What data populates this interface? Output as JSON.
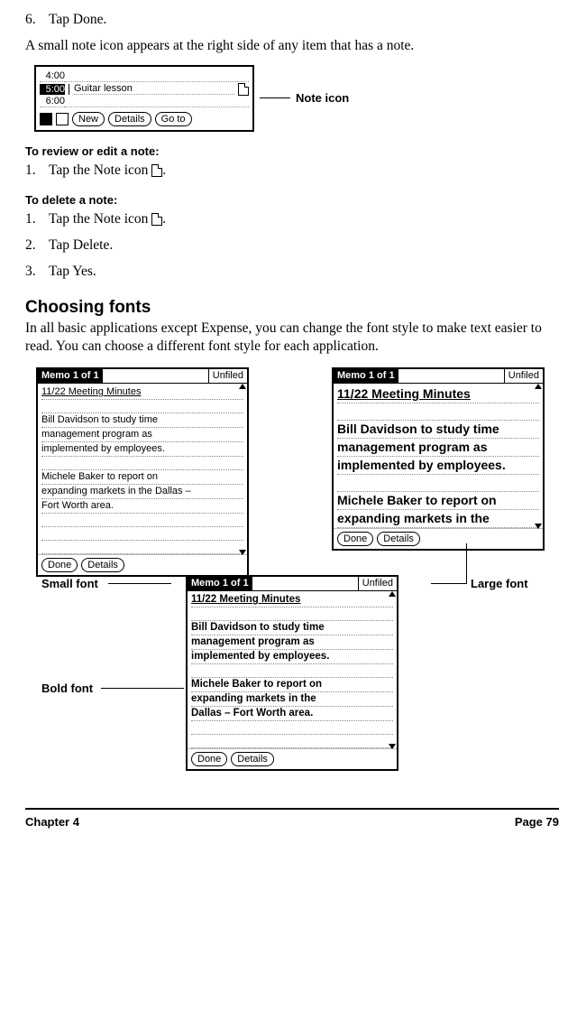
{
  "steps_top": {
    "num6": "6.",
    "text6": "Tap Done."
  },
  "para_noteicon": "A small note icon appears at the right side of any item that has a note.",
  "noteicon_figure": {
    "times": [
      "4:00",
      "5:00",
      "6:00"
    ],
    "event": "Guitar lesson",
    "btn_new": "New",
    "btn_details": "Details",
    "btn_goto": "Go to",
    "callout": "Note icon"
  },
  "h_review": "To review or edit a note:",
  "review_step1_num": "1.",
  "review_step1_text": "Tap the Note icon ",
  "review_step1_trail": ".",
  "h_delete": "To delete a note:",
  "delete_steps": [
    {
      "num": "1.",
      "text": "Tap the Note icon ",
      "trail": "."
    },
    {
      "num": "2.",
      "text": "Tap Delete.",
      "trail": ""
    },
    {
      "num": "3.",
      "text": "Tap Yes.",
      "trail": ""
    }
  ],
  "h_fonts": "Choosing fonts",
  "para_fonts": "In all basic applications except Expense, you can change the font style to make text easier to read. You can choose a different font style for each application.",
  "memo_common": {
    "title": "Memo 1 of 1",
    "category": "Unfiled",
    "line1": "11/22 Meeting Minutes",
    "para1a": "Bill Davidson to study time",
    "para1b": "management program as",
    "para1c": "implemented by employees.",
    "para2a": "Michele Baker to report on",
    "para2b": "expanding markets in the Dallas –",
    "para2c": "Fort Worth area.",
    "btn_done": "Done",
    "btn_details": "Details"
  },
  "memo_large": {
    "para2a": "Michele Baker to report on",
    "para2b": "expanding markets in the"
  },
  "memo_bold": {
    "para2b": "expanding markets in the",
    "para2c": "Dallas – Fort Worth area."
  },
  "labels": {
    "small": "Small font",
    "large": "Large font",
    "bold": "Bold font"
  },
  "footer": {
    "left": "Chapter 4",
    "right": "Page 79"
  }
}
